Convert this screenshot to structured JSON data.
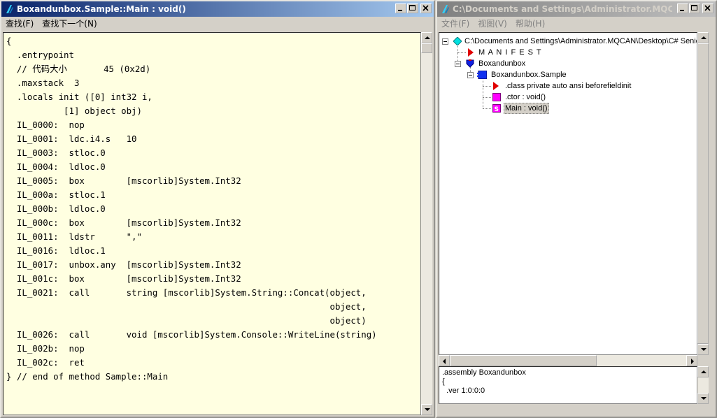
{
  "left_window": {
    "title": "Boxandunbox.Sample::Main : void()",
    "menu": [
      "查找(F)",
      "查找下一个(N)"
    ],
    "code": "{\n  .entrypoint\n  // 代码大小       45 (0x2d)\n  .maxstack  3\n  .locals init ([0] int32 i,\n           [1] object obj)\n  IL_0000:  nop\n  IL_0001:  ldc.i4.s   10\n  IL_0003:  stloc.0\n  IL_0004:  ldloc.0\n  IL_0005:  box        [mscorlib]System.Int32\n  IL_000a:  stloc.1\n  IL_000b:  ldloc.0\n  IL_000c:  box        [mscorlib]System.Int32\n  IL_0011:  ldstr      \",\"\n  IL_0016:  ldloc.1\n  IL_0017:  unbox.any  [mscorlib]System.Int32\n  IL_001c:  box        [mscorlib]System.Int32\n  IL_0021:  call       string [mscorlib]System.String::Concat(object,\n                                                              object,\n                                                              object)\n  IL_0026:  call       void [mscorlib]System.Console::WriteLine(string)\n  IL_002b:  nop\n  IL_002c:  ret\n} // end of method Sample::Main"
  },
  "right_window": {
    "title": "C:\\Documents and Settings\\Administrator.MQCAN\\D...",
    "menu": [
      "文件(F)",
      "视图(V)",
      "帮助(H)"
    ],
    "tree": {
      "root": "C:\\Documents and Settings\\Administrator.MQCAN\\Desktop\\C# Seniot\\Bo",
      "manifest": "M A N I F E S T",
      "assembly": "Boxandunbox",
      "class": "Boxandunbox.Sample",
      "class_decl": ".class private auto ansi beforefieldinit",
      "ctor": ".ctor : void()",
      "main": "Main : void()"
    },
    "bottom_pane": [
      ".assembly Boxandunbox",
      "{",
      "  .ver 1:0:0:0"
    ]
  },
  "colors": {
    "title_active": "#0a246a",
    "title_inactive": "#808080",
    "code_background": "#ffffe1"
  },
  "icons": [
    "app-icon",
    "minimize-icon",
    "maximize-icon",
    "close-icon",
    "diamond-icon",
    "red-triangle-icon",
    "shield-icon",
    "class-icon",
    "method-icon",
    "static-method-icon"
  ]
}
